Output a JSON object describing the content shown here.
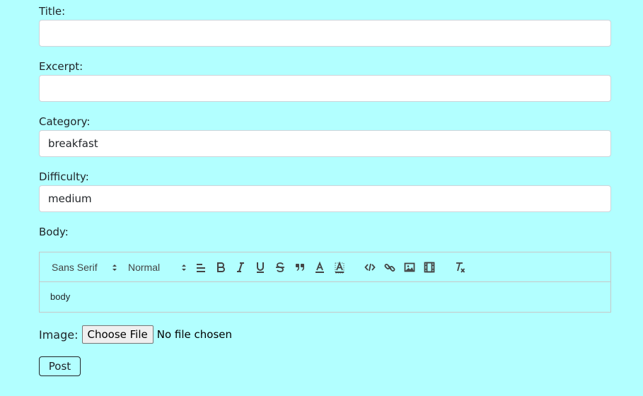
{
  "form": {
    "title_label": "Title:",
    "title_value": "",
    "excerpt_label": "Excerpt:",
    "excerpt_value": "",
    "category_label": "Category:",
    "category_value": "breakfast",
    "difficulty_label": "Difficulty:",
    "difficulty_value": "medium",
    "body_label": "Body:",
    "image_label": "Image:",
    "choose_file_label": "Choose File",
    "file_status": "No file chosen",
    "post_label": "Post"
  },
  "editor": {
    "font_picker": "Sans Serif",
    "size_picker": "Normal",
    "content": "body",
    "toolbar_icons": [
      "align-icon",
      "bold-icon",
      "italic-icon",
      "underline-icon",
      "strikethrough-icon",
      "blockquote-icon",
      "text-color-icon",
      "background-color-icon",
      "code-icon",
      "link-icon",
      "image-icon",
      "video-icon",
      "clear-format-icon"
    ]
  },
  "colors": {
    "background": "#b2ffff",
    "field_border": "#ced4da",
    "editor_border": "#c7c7c7"
  }
}
